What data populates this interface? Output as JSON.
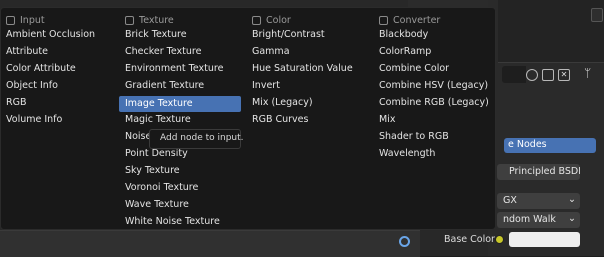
{
  "menu": {
    "columns": [
      {
        "heading": "Input",
        "items": [
          "Ambient Occlusion",
          "Attribute",
          "Color Attribute",
          "Object Info",
          "RGB",
          "Volume Info"
        ]
      },
      {
        "heading": "Texture",
        "items": [
          "Brick Texture",
          "Checker Texture",
          "Environment Texture",
          "Gradient Texture",
          "Image Texture",
          "Magic Texture",
          "Noise Texture",
          "Point Density",
          "Sky Texture",
          "Voronoi Texture",
          "Wave Texture",
          "White Noise Texture"
        ]
      },
      {
        "heading": "Color",
        "items": [
          "Bright/Contrast",
          "Gamma",
          "Hue Saturation Value",
          "Invert",
          "Mix (Legacy)",
          "RGB Curves"
        ]
      },
      {
        "heading": "Converter",
        "items": [
          "Blackbody",
          "ColorRamp",
          "Combine Color",
          "Combine HSV (Legacy)",
          "Combine RGB (Legacy)",
          "Mix",
          "Shader to RGB",
          "Wavelength"
        ]
      }
    ],
    "active_item": "Image Texture",
    "tooltip": "Add node to input."
  },
  "properties": {
    "selected_node": "e Nodes",
    "surface_shader": "Principled BSDF",
    "distribution_value": "GX",
    "subsurface_value": "ndom Walk",
    "base_color_label": "Base Color"
  }
}
